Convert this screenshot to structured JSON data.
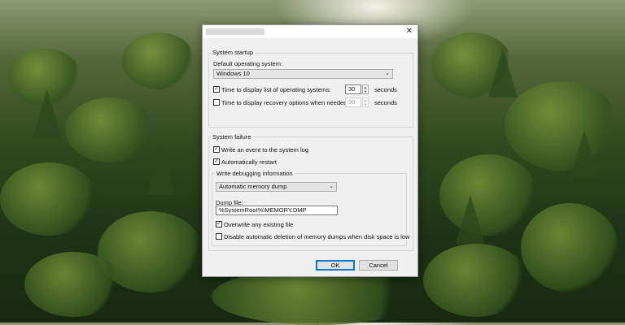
{
  "dialog": {
    "title": "",
    "close_glyph": "✕"
  },
  "startup": {
    "group_title": "System startup",
    "default_os_label": "Default operating system:",
    "default_os_value": "Windows 10",
    "display_list_label": "Time to display list of operating systems:",
    "display_list_checked": true,
    "display_list_value": "30",
    "display_list_unit": "seconds",
    "recovery_label": "Time to display recovery options when needed:",
    "recovery_checked": false,
    "recovery_value": "30",
    "recovery_unit": "seconds"
  },
  "failure": {
    "group_title": "System failure",
    "write_event_label": "Write an event to the system log",
    "write_event_checked": true,
    "auto_restart_label": "Automatically restart",
    "auto_restart_checked": true,
    "debug_group_title": "Write debugging information",
    "dump_type_value": "Automatic memory dump",
    "dump_file_label": "Dump file:",
    "dump_file_value": "%SystemRoot%\\MEMORY.DMP",
    "overwrite_label": "Overwrite any existing file",
    "overwrite_checked": true,
    "disable_delete_label": "Disable automatic deletion of memory dumps when disk space is low",
    "disable_delete_checked": false
  },
  "buttons": {
    "ok_label": "OK",
    "cancel_label": "Cancel"
  },
  "icons": {
    "check": "✓",
    "up": "▲",
    "down": "▼",
    "chevron": "⌄"
  }
}
